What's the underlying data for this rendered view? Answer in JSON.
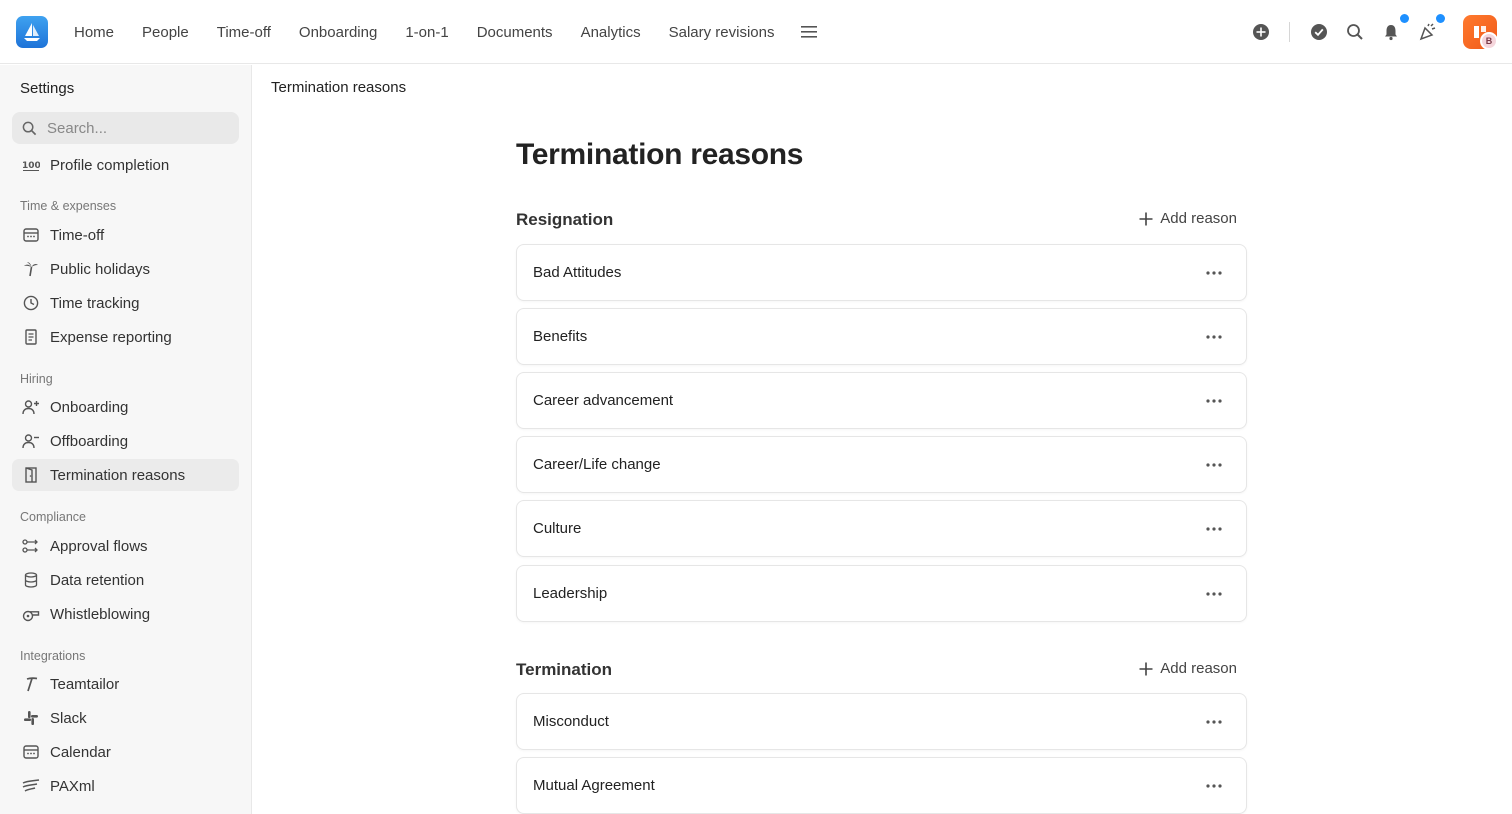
{
  "nav": {
    "items": [
      "Home",
      "People",
      "Time-off",
      "Onboarding",
      "1-on-1",
      "Documents",
      "Analytics",
      "Salary revisions"
    ]
  },
  "avatar": {
    "badge": "B",
    "accent": "#f05a1a"
  },
  "sidebar": {
    "title": "Settings",
    "search_placeholder": "Search...",
    "profile_completion": "Profile completion",
    "sections": {
      "time": "Time & expenses",
      "hiring": "Hiring",
      "compliance": "Compliance",
      "integrations": "Integrations"
    },
    "items": {
      "time_off": "Time-off",
      "public_holidays": "Public holidays",
      "time_tracking": "Time tracking",
      "expense_reporting": "Expense reporting",
      "onboarding": "Onboarding",
      "offboarding": "Offboarding",
      "termination_reasons": "Termination reasons",
      "approval_flows": "Approval flows",
      "data_retention": "Data retention",
      "whistleblowing": "Whistleblowing",
      "teamtailor": "Teamtailor",
      "slack": "Slack",
      "calendar": "Calendar",
      "paxml": "PAXml"
    }
  },
  "main": {
    "breadcrumb": "Termination reasons",
    "title": "Termination reasons",
    "add_label": "Add reason",
    "resignation": {
      "title": "Resignation",
      "reasons": [
        "Bad Attitudes",
        "Benefits",
        "Career advancement",
        "Career/Life change",
        "Culture",
        "Leadership"
      ]
    },
    "termination": {
      "title": "Termination",
      "reasons": [
        "Misconduct",
        "Mutual Agreement"
      ]
    }
  },
  "colors": {
    "notification_dot": "#1e90ff",
    "logo": "#1e73d8"
  }
}
